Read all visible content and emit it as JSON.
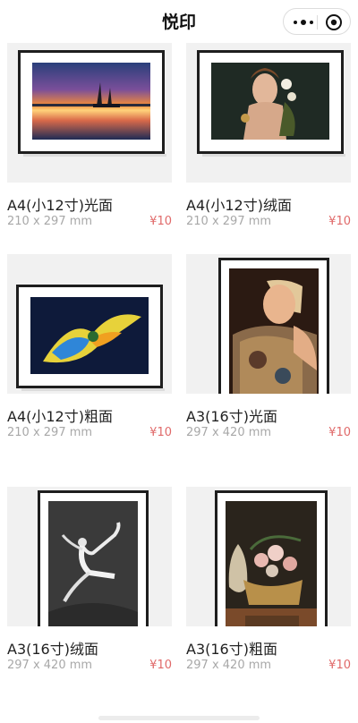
{
  "header": {
    "title": "悦印",
    "more_icon": "more-dots-icon",
    "close_icon": "target-close-icon"
  },
  "products": [
    {
      "name": "A4(小12寸)光面",
      "size": "210 x 297 mm",
      "price": "¥10",
      "orientation": "landscape",
      "artwork": "sunset-boats"
    },
    {
      "name": "A4(小12寸)绒面",
      "size": "210 x 297 mm",
      "price": "¥10",
      "orientation": "landscape",
      "artwork": "floral-portrait"
    },
    {
      "name": "A4(小12寸)粗面",
      "size": "210 x 297 mm",
      "price": "¥10",
      "orientation": "landscape",
      "artwork": "color-parrot"
    },
    {
      "name": "A3(16寸)光面",
      "size": "297 x 420 mm",
      "price": "¥10",
      "orientation": "portrait",
      "artwork": "woman-portrait"
    },
    {
      "name": "A3(16寸)绒面",
      "size": "297 x 420 mm",
      "price": "¥10",
      "orientation": "portrait",
      "artwork": "ballet-dancer"
    },
    {
      "name": "A3(16寸)粗面",
      "size": "297 x 420 mm",
      "price": "¥10",
      "orientation": "portrait",
      "artwork": "flower-vase"
    }
  ],
  "colors": {
    "price": "#e06a6a",
    "secondary_text": "#a8a8a8",
    "card_bg": "#f1f1f1",
    "frame": "#1c1c1c"
  }
}
